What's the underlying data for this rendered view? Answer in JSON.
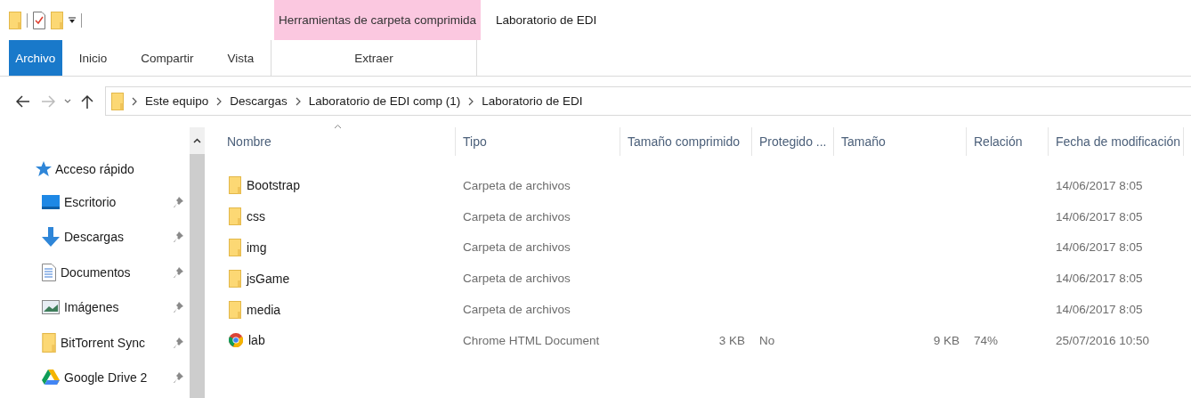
{
  "title_bar": {
    "contextual_group": "Herramientas de carpeta comprimida",
    "window_title": "Laboratorio de EDI"
  },
  "ribbon_tabs": [
    {
      "label": "Archivo",
      "kind": "file"
    },
    {
      "label": "Inicio",
      "kind": "tab"
    },
    {
      "label": "Compartir",
      "kind": "tab"
    },
    {
      "label": "Vista",
      "kind": "tab"
    },
    {
      "label": "Extraer",
      "kind": "contextual"
    }
  ],
  "address_bar": {
    "breadcrumbs": [
      "Este equipo",
      "Descargas",
      "Laboratorio de EDI comp (1)",
      "Laboratorio de EDI"
    ]
  },
  "sidebar": {
    "header": "Acceso rápido",
    "items": [
      {
        "label": "Escritorio",
        "pinned": true
      },
      {
        "label": "Descargas",
        "pinned": true
      },
      {
        "label": "Documentos",
        "pinned": true
      },
      {
        "label": "Imágenes",
        "pinned": true
      },
      {
        "label": "BitTorrent Sync",
        "pinned": true
      },
      {
        "label": "Google Drive 2",
        "pinned": true
      }
    ]
  },
  "table": {
    "columns": [
      {
        "label": "Nombre",
        "sorted": true
      },
      {
        "label": "Tipo",
        "sorted": false
      },
      {
        "label": "Tamaño comprimido",
        "sorted": false
      },
      {
        "label": "Protegido ...",
        "sorted": false
      },
      {
        "label": "Tamaño",
        "sorted": false
      },
      {
        "label": "Relación",
        "sorted": false
      },
      {
        "label": "Fecha de modificación",
        "sorted": false
      }
    ],
    "rows": [
      {
        "kind": "folder",
        "name": "Bootstrap",
        "type": "Carpeta de archivos",
        "date": "14/06/2017 8:05"
      },
      {
        "kind": "folder",
        "name": "css",
        "type": "Carpeta de archivos",
        "date": "14/06/2017 8:05"
      },
      {
        "kind": "folder",
        "name": "img",
        "type": "Carpeta de archivos",
        "date": "14/06/2017 8:05"
      },
      {
        "kind": "folder",
        "name": "jsGame",
        "type": "Carpeta de archivos",
        "date": "14/06/2017 8:05"
      },
      {
        "kind": "folder",
        "name": "media",
        "type": "Carpeta de archivos",
        "date": "14/06/2017 8:05"
      },
      {
        "kind": "html",
        "name": "lab",
        "type": "Chrome HTML Document",
        "compressed_size": "3 KB",
        "protected": "No",
        "size": "9 KB",
        "ratio": "74%",
        "date": "25/07/2016 10:50"
      }
    ]
  }
}
